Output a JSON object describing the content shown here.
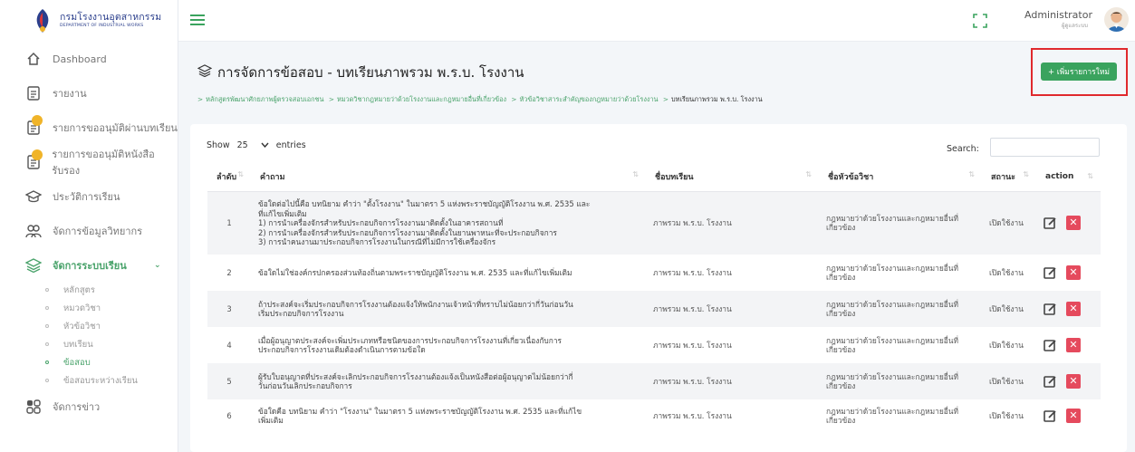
{
  "brand": {
    "name_th": "กรมโรงงานอุตสาหกรรม",
    "name_en": "DEPARTMENT OF INDUSTRIAL WORKS"
  },
  "sidebar": {
    "items": [
      {
        "label": "Dashboard",
        "icon": "home-icon"
      },
      {
        "label": "รายงาน",
        "icon": "report-icon"
      },
      {
        "label": "รายการขออนุมัติผ่านบทเรียน",
        "icon": "document-icon",
        "badge": true
      },
      {
        "label": "รายการขออนุมัติหนังสือรับรอง",
        "icon": "document-icon",
        "badge": true
      },
      {
        "label": "ประวัติการเรียน",
        "icon": "graduation-cap-icon"
      },
      {
        "label": "จัดการข้อมูลวิทยากร",
        "icon": "users-icon"
      },
      {
        "label": "จัดการระบบเรียน",
        "icon": "course-icon",
        "active": true
      },
      {
        "label": "จัดการข่าว",
        "icon": "grid-icon"
      }
    ],
    "sub_items": [
      "หลักสูตร",
      "หมวดวิชา",
      "หัวข้อวิชา",
      "บทเรียน",
      "ข้อสอบ",
      "ข้อสอบระหว่างเรียน"
    ]
  },
  "topbar": {
    "admin_name": "Administrator",
    "admin_role": "ผู้ดูแลระบบ"
  },
  "page": {
    "title": "การจัดการข้อสอบ - บทเรียนภาพรวม พ.ร.บ. โรงงาน",
    "add_button": "+ เพิ่มรายการใหม่",
    "breadcrumb": [
      "หลักสูตรพัฒนาศักยภาพผู้ตรวจสอบเอกชน",
      "หมวดวิชากฎหมายว่าด้วยโรงงานและกฎหมายอื่นที่เกี่ยวข้อง",
      "หัวข้อวิชาสาระสำคัญของกฎหมายว่าด้วยโรงงาน",
      "บทเรียนภาพรวม พ.ร.บ. โรงงาน"
    ]
  },
  "table_controls": {
    "show_label": "Show",
    "show_value": "25",
    "entries_label": "entries",
    "search_label": "Search:"
  },
  "table": {
    "headers": [
      "ลำดับ",
      "คำถาม",
      "ชื่อบทเรียน",
      "ชื่อหัวข้อวิชา",
      "สถานะ",
      "action"
    ],
    "rows": [
      {
        "no": "1",
        "q": [
          "ข้อใดต่อไปนี้คือ บทนิยาม คำว่า \"ตั้งโรงงาน\" ในมาตรา 5 แห่งพระราชบัญญัติโรงงาน พ.ศ. 2535 และ",
          "ที่แก้ไขเพิ่มเติม",
          "1) การนำเครื่องจักรสำหรับประกอบกิจการโรงงานมาติดตั้งในอาคารสถานที่",
          "2) การนำเครื่องจักรสำหรับประกอบกิจการโรงงานมาติดตั้งในยานพาหนะที่จะประกอบกิจการ",
          "3) การนำคนงานมาประกอบกิจการโรงงานในกรณีที่ไม่มีการใช้เครื่องจักร"
        ],
        "lesson": "ภาพรวม พ.ร.บ. โรงงาน",
        "topic": [
          "กฎหมายว่าด้วยโรงงานและกฎหมายอื่นที่",
          "เกี่ยวข้อง"
        ],
        "status": "เปิดใช้งาน"
      },
      {
        "no": "2",
        "q": [
          "ข้อใดไม่ใช่องค์กรปกครองส่วนท้องถิ่นตามพระราชบัญญัติโรงงาน พ.ศ. 2535 และที่แก้ไขเพิ่มเติม"
        ],
        "lesson": "ภาพรวม พ.ร.บ. โรงงาน",
        "topic": [
          "กฎหมายว่าด้วยโรงงานและกฎหมายอื่นที่",
          "เกี่ยวข้อง"
        ],
        "status": "เปิดใช้งาน"
      },
      {
        "no": "3",
        "q": [
          "ถ้าประสงค์จะเริ่มประกอบกิจการโรงงานต้องแจ้งให้พนักงานเจ้าหน้าที่ทราบไม่น้อยกว่ากี่วันก่อนวัน",
          "เริ่มประกอบกิจการโรงงาน"
        ],
        "lesson": "ภาพรวม พ.ร.บ. โรงงาน",
        "topic": [
          "กฎหมายว่าด้วยโรงงานและกฎหมายอื่นที่",
          "เกี่ยวข้อง"
        ],
        "status": "เปิดใช้งาน"
      },
      {
        "no": "4",
        "q": [
          "เมื่อผู้อนุญาตประสงค์จะเพิ่มประเภทหรือชนิดของการประกอบกิจการโรงงานที่เกี่ยวเนื่องกับการ",
          "ประกอบกิจการโรงงานเดิมต้องดำเนินการตามข้อใด"
        ],
        "lesson": "ภาพรวม พ.ร.บ. โรงงาน",
        "topic": [
          "กฎหมายว่าด้วยโรงงานและกฎหมายอื่นที่",
          "เกี่ยวข้อง"
        ],
        "status": "เปิดใช้งาน"
      },
      {
        "no": "5",
        "q": [
          "ผู้รับใบอนุญาตที่ประสงค์จะเลิกประกอบกิจการโรงงานต้องแจ้งเป็นหนังสือต่อผู้อนุญาตไม่น้อยกว่ากี่",
          "วันก่อนวันเลิกประกอบกิจการ"
        ],
        "lesson": "ภาพรวม พ.ร.บ. โรงงาน",
        "topic": [
          "กฎหมายว่าด้วยโรงงานและกฎหมายอื่นที่",
          "เกี่ยวข้อง"
        ],
        "status": "เปิดใช้งาน"
      },
      {
        "no": "6",
        "q": [
          "ข้อใดคือ บทนิยาม คำว่า \"โรงงาน\" ในมาตรา 5 แห่งพระราชบัญญัติโรงงาน พ.ศ. 2535 และที่แก้ไข",
          "เพิ่มเติม"
        ],
        "lesson": "ภาพรวม พ.ร.บ. โรงงาน",
        "topic": [
          "กฎหมายว่าด้วยโรงงานและกฎหมายอื่นที่",
          "เกี่ยวข้อง"
        ],
        "status": "เปิดใช้งาน"
      }
    ]
  },
  "colors": {
    "accent": "#3aa35e",
    "highlight_box": "#e0292d",
    "delete": "#e54a5d",
    "badge": "#f0b429"
  }
}
